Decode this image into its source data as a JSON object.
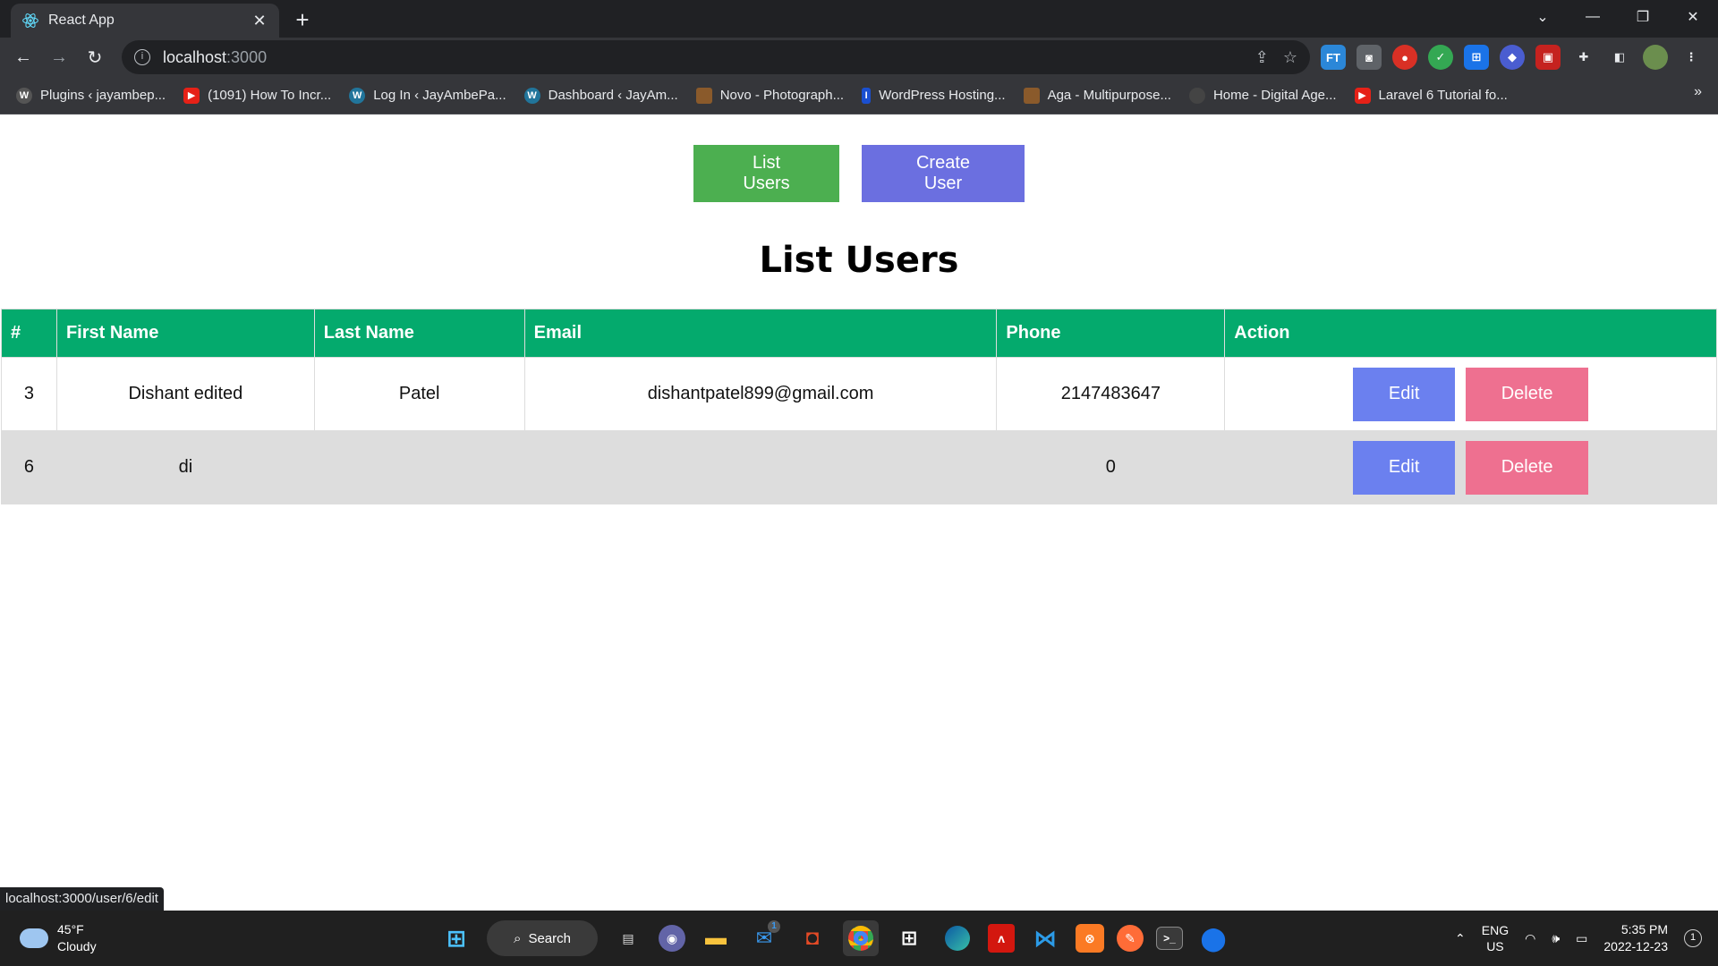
{
  "browser": {
    "tab_title": "React App",
    "url_host": "localhost",
    "url_port": ":3000",
    "bookmarks": [
      {
        "label": "Plugins ‹ jayambep...",
        "icon": "wordpress-icon",
        "color": "#555"
      },
      {
        "label": "(1091) How To Incr...",
        "icon": "youtube-icon",
        "color": "#e62117"
      },
      {
        "label": "Log In ‹ JayAmbePa...",
        "icon": "wordpress-icon",
        "color": "#21759b"
      },
      {
        "label": "Dashboard ‹ JayAm...",
        "icon": "wordpress-icon",
        "color": "#21759b"
      },
      {
        "label": "Novo - Photograph...",
        "icon": "theme-icon",
        "color": "#8a5a2b"
      },
      {
        "label": "WordPress Hosting...",
        "icon": "hosting-icon",
        "color": "#1a4fd0"
      },
      {
        "label": "Aga - Multipurpose...",
        "icon": "theme-icon",
        "color": "#8a5a2b"
      },
      {
        "label": "Home - Digital Age...",
        "icon": "site-icon",
        "color": "#444"
      },
      {
        "label": "Laravel 6 Tutorial fo...",
        "icon": "youtube-icon",
        "color": "#e62117"
      }
    ],
    "more_bookmarks": "»",
    "status_url": "localhost:3000/user/6/edit"
  },
  "app": {
    "nav": {
      "list_label": "List Users",
      "create_label": "Create User"
    },
    "heading": "List Users",
    "table": {
      "headers": [
        "#",
        "First Name",
        "Last Name",
        "Email",
        "Phone",
        "Action"
      ],
      "rows": [
        {
          "id": "3",
          "first": "Dishant edited",
          "last": "Patel",
          "email": "dishantpatel899@gmail.com",
          "phone": "2147483647"
        },
        {
          "id": "6",
          "first": "di",
          "last": "",
          "email": "",
          "phone": "0"
        }
      ],
      "edit_label": "Edit",
      "delete_label": "Delete"
    }
  },
  "taskbar": {
    "weather_temp": "45°F",
    "weather_desc": "Cloudy",
    "search_label": "Search",
    "lang_top": "ENG",
    "lang_bottom": "US",
    "time": "5:35 PM",
    "date": "2022-12-23",
    "notification_count": "1",
    "mail_badge": "1"
  }
}
